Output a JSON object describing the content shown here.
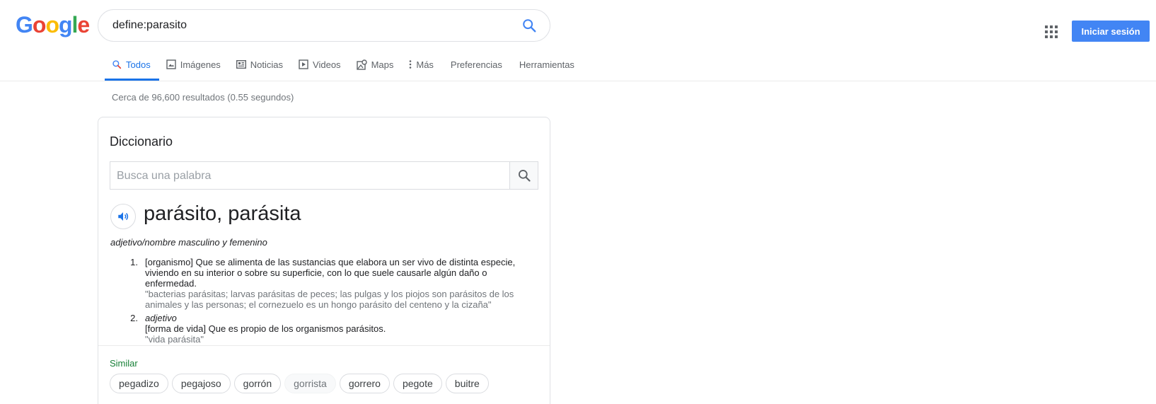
{
  "header": {
    "logo_letters": [
      {
        "ch": "G",
        "color": "#4285F4"
      },
      {
        "ch": "o",
        "color": "#EA4335"
      },
      {
        "ch": "o",
        "color": "#FBBC05"
      },
      {
        "ch": "g",
        "color": "#4285F4"
      },
      {
        "ch": "l",
        "color": "#34A853"
      },
      {
        "ch": "e",
        "color": "#EA4335"
      }
    ],
    "query": "define:parasito",
    "signin_label": "Iniciar sesión",
    "accent_color": "#1a73e8"
  },
  "tabs": [
    {
      "label": "Todos",
      "icon": "search-icon",
      "active": true
    },
    {
      "label": "Imágenes",
      "icon": "image-icon"
    },
    {
      "label": "Noticias",
      "icon": "news-icon"
    },
    {
      "label": "Videos",
      "icon": "video-icon"
    },
    {
      "label": "Maps",
      "icon": "map-icon"
    },
    {
      "label": "Más",
      "icon": "more-icon"
    },
    {
      "label": "Preferencias"
    },
    {
      "label": "Herramientas"
    }
  ],
  "results_stats": "Cerca de 96,600 resultados (0.55 segundos)",
  "dictionary": {
    "title": "Diccionario",
    "input_placeholder": "Busca una palabra",
    "headword": "parásito, parásita",
    "part_of_speech": "adjetivo/nombre masculino y femenino",
    "definitions": [
      {
        "num": "1.",
        "text": "[organismo] Que se alimenta de las sustancias que elabora un ser vivo de distinta especie, viviendo en su interior o sobre su superficie, con lo que suele causarle algún daño o enfermedad.",
        "example": "\"bacterias parásitas; larvas parásitas de peces; las pulgas y los piojos son parásitos de los animales y las personas; el cornezuelo es un hongo parásito del centeno y la cizaña\""
      },
      {
        "num": "2.",
        "label": "adjetivo",
        "text": "[forma de vida] Que es propio de los organismos parásitos.",
        "example": "\"vida parásita\""
      }
    ],
    "similar_label": "Similar",
    "similar": [
      "pegadizo",
      "pegajoso",
      "gorrón",
      "gorrista",
      "gorrero",
      "pegote",
      "buitre"
    ]
  }
}
